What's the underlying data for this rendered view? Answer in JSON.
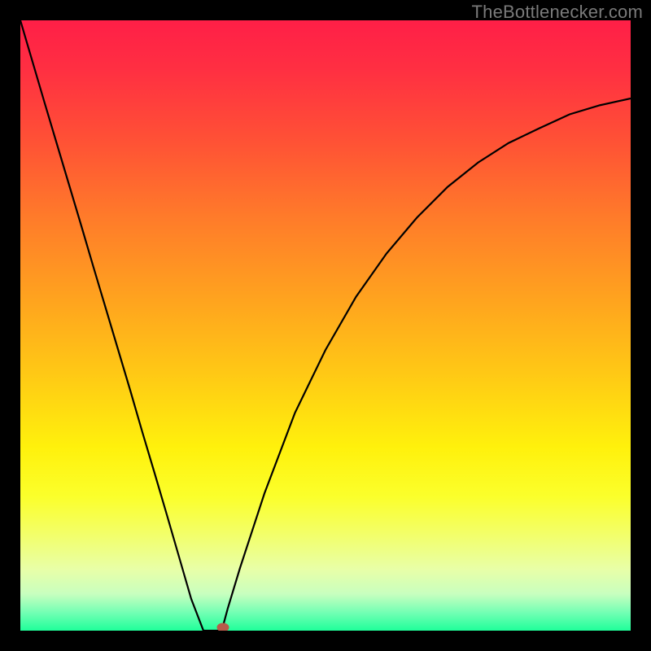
{
  "watermark": "TheBottlenecker.com",
  "chart_data": {
    "type": "line",
    "title": "",
    "xlabel": "",
    "ylabel": "",
    "xlim": [
      0,
      1
    ],
    "ylim": [
      0,
      1
    ],
    "x": [
      0.0,
      0.02,
      0.04,
      0.06,
      0.08,
      0.1,
      0.12,
      0.14,
      0.16,
      0.18,
      0.2,
      0.22,
      0.24,
      0.26,
      0.28,
      0.3,
      0.305,
      0.33,
      0.34,
      0.36,
      0.4,
      0.45,
      0.5,
      0.55,
      0.6,
      0.65,
      0.7,
      0.75,
      0.8,
      0.85,
      0.9,
      0.95,
      1.0
    ],
    "y": [
      1.0,
      0.932,
      0.864,
      0.797,
      0.73,
      0.663,
      0.595,
      0.528,
      0.461,
      0.394,
      0.325,
      0.258,
      0.19,
      0.121,
      0.052,
      0.0,
      0.0,
      0.0,
      0.037,
      0.103,
      0.225,
      0.357,
      0.46,
      0.547,
      0.618,
      0.677,
      0.727,
      0.767,
      0.799,
      0.823,
      0.846,
      0.861,
      0.872
    ],
    "marker": {
      "x": 0.332,
      "y": 0.0
    },
    "gradient_colors": {
      "top": "#ff1f47",
      "upper_mid": "#ffa11f",
      "mid": "#fff10c",
      "lower_mid": "#e8ffa8",
      "bottom": "#1fff9a"
    }
  }
}
